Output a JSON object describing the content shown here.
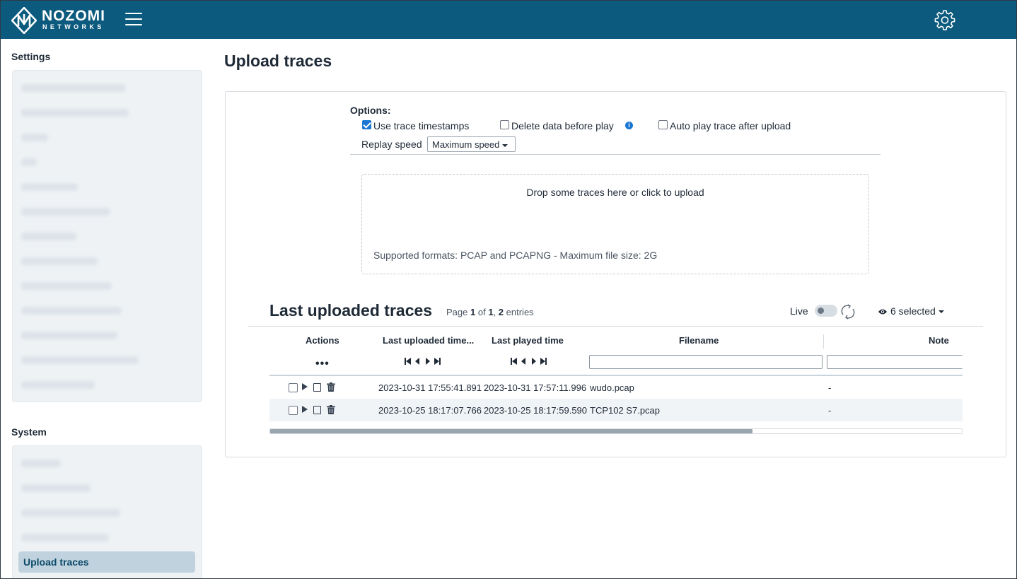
{
  "header": {
    "brand_name": "NOZOMI",
    "brand_sub": "NETWORKS",
    "icons": {
      "logo": "nozomi-logo",
      "menu": "hamburger-icon",
      "settings": "gear-icon"
    }
  },
  "sidebar": {
    "settings_title": "Settings",
    "system_title": "System",
    "active_item": "Upload traces"
  },
  "page": {
    "title": "Upload traces"
  },
  "options": {
    "label": "Options:",
    "use_timestamps": "Use trace timestamps",
    "use_timestamps_checked": true,
    "delete_before_play": "Delete data before play",
    "delete_before_play_checked": false,
    "auto_play": "Auto play trace after upload",
    "auto_play_checked": false,
    "replay_speed_label": "Replay speed",
    "replay_speed_value": "Maximum speed"
  },
  "dropzone": {
    "text": "Drop some traces here or click to upload",
    "hint": "Supported formats: PCAP and PCAPNG - Maximum file size: 2G"
  },
  "traces": {
    "title": "Last uploaded traces",
    "page_prefix": "Page",
    "page_current": "1",
    "page_of": "of",
    "page_total": "1",
    "entries_count": "2",
    "entries_label": "entries",
    "live_label": "Live",
    "selected_label": "6 selected",
    "columns": {
      "actions": "Actions",
      "last_uploaded": "Last uploaded time...",
      "last_played": "Last played time",
      "filename": "Filename",
      "note": "Note"
    },
    "actions_menu": "•••",
    "rows": [
      {
        "uploaded": "2023-10-31 17:55:41.891",
        "played": "2023-10-31 17:57:11.996",
        "filename": "wudo.pcap",
        "note": "-"
      },
      {
        "uploaded": "2023-10-25 18:17:07.766",
        "played": "2023-10-25 18:17:59.590",
        "filename": "TCP102 S7.pcap",
        "note": "-"
      }
    ]
  }
}
